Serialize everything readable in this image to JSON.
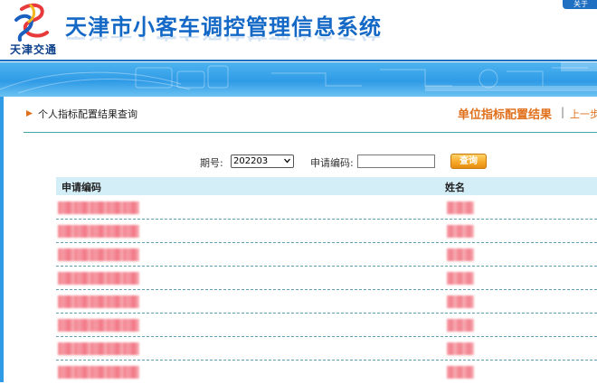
{
  "header": {
    "site_title": "天津市小客车调控管理信息系统",
    "logo_text": "天津交通",
    "top_right_label": "关于"
  },
  "section": {
    "title": "个人指标配置结果查询",
    "unit_result_link": "单位指标配置结果",
    "separator": "|",
    "prev_link": "上一步"
  },
  "form": {
    "period_label": "期号:",
    "period_value": "202203",
    "code_label": "申请编码:",
    "code_value": "",
    "query_button": "查询"
  },
  "table": {
    "columns": [
      "申请编码",
      "姓名"
    ],
    "rows": [
      {
        "code": "",
        "name": ""
      },
      {
        "code": "",
        "name": ""
      },
      {
        "code": "",
        "name": ""
      },
      {
        "code": "",
        "name": ""
      },
      {
        "code": "",
        "name": ""
      },
      {
        "code": "",
        "name": ""
      },
      {
        "code": "",
        "name": ""
      },
      {
        "code": "",
        "name": ""
      }
    ]
  },
  "colors": {
    "accent_blue": "#1468c6",
    "banner_blue": "#2f9be6",
    "orange": "#e0701c",
    "table_header_bg": "#d4eef8",
    "redaction": "#f26d7a"
  },
  "icons": [
    "logo-icon",
    "arrow-right-icon",
    "chevron-down-icon"
  ]
}
